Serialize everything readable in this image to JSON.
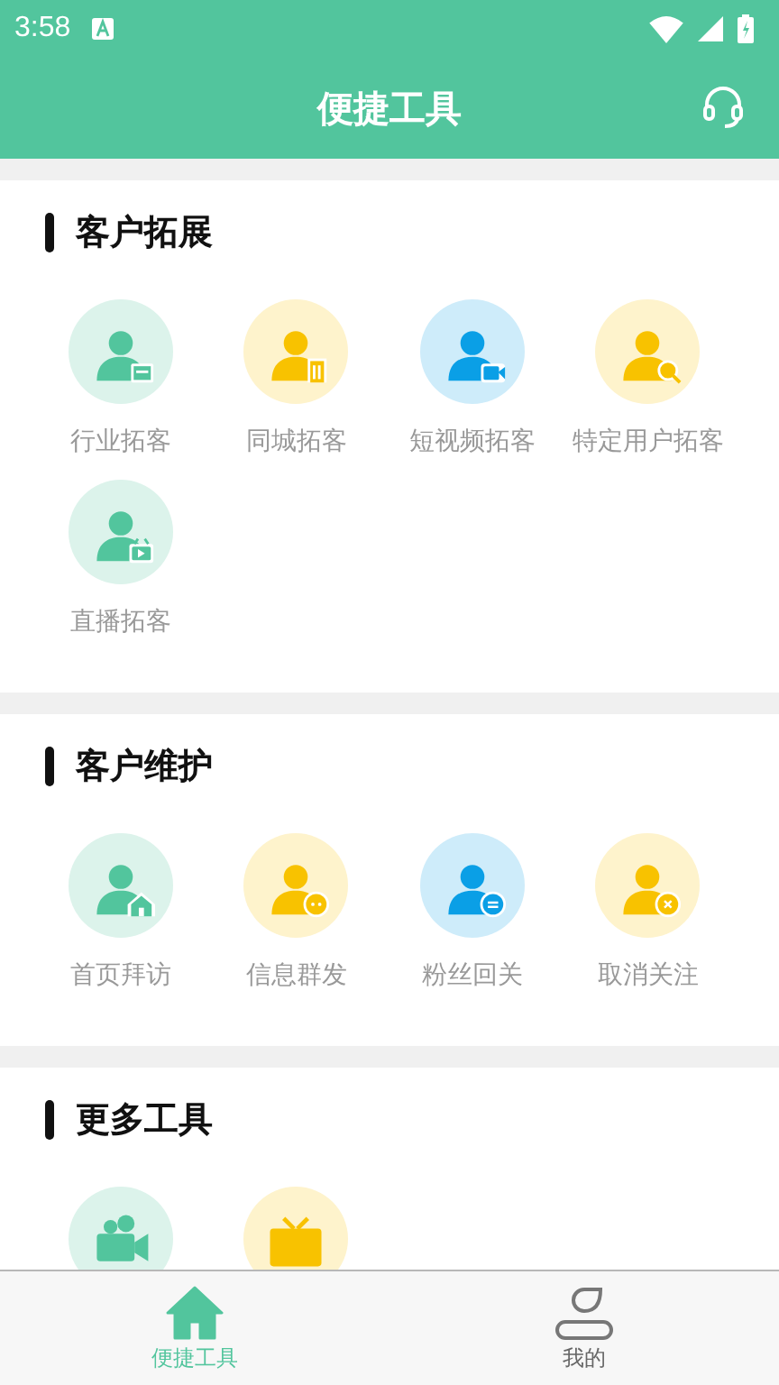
{
  "status_bar": {
    "time": "3:58"
  },
  "header": {
    "title": "便捷工具"
  },
  "sections": [
    {
      "title": "客户拓展",
      "tools": [
        {
          "label": "行业拓客",
          "color": "#52c59d",
          "kind": "shop"
        },
        {
          "label": "同城拓客",
          "color": "#f8c200",
          "kind": "building"
        },
        {
          "label": "短视频拓客",
          "color": "#0a9fe6",
          "kind": "camera"
        },
        {
          "label": "特定用户拓客",
          "color": "#f8c200",
          "kind": "search"
        },
        {
          "label": "直播拓客",
          "color": "#52c59d",
          "kind": "tv"
        }
      ]
    },
    {
      "title": "客户维护",
      "tools": [
        {
          "label": "首页拜访",
          "color": "#52c59d",
          "kind": "home"
        },
        {
          "label": "信息群发",
          "color": "#f8c200",
          "kind": "chat"
        },
        {
          "label": "粉丝回关",
          "color": "#0a9fe6",
          "kind": "swap"
        },
        {
          "label": "取消关注",
          "color": "#f8c200",
          "kind": "close"
        }
      ]
    },
    {
      "title": "更多工具",
      "tools": [
        {
          "color": "#52c59d",
          "kind": "camcorder"
        },
        {
          "color": "#f8c200",
          "kind": "television"
        }
      ]
    }
  ],
  "nav": [
    {
      "label": "便捷工具",
      "selected": true,
      "kind": "home"
    },
    {
      "label": "我的",
      "selected": false,
      "kind": "user"
    }
  ]
}
